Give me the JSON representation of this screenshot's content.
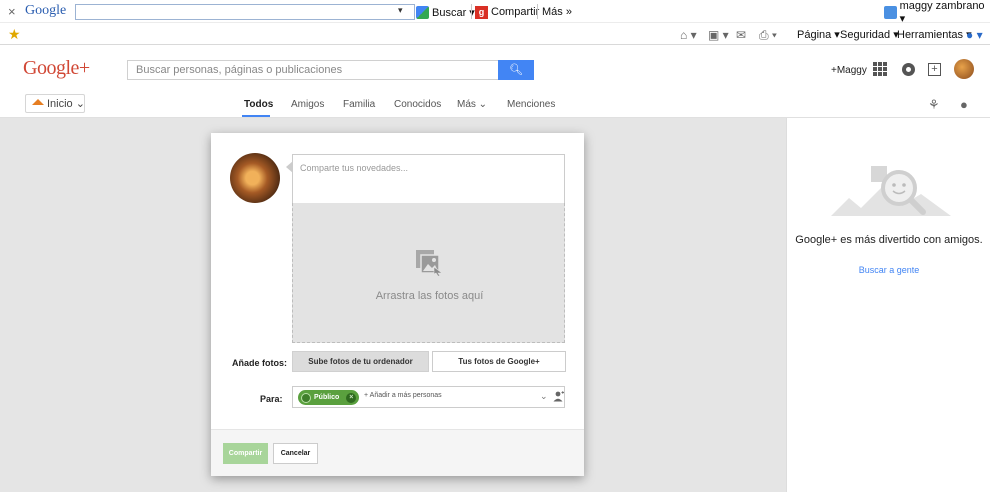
{
  "ie_toolbar": {
    "close": "×",
    "google_logo": "Google",
    "search_value": "",
    "dropdown": "▾",
    "buscar": "Buscar ▾",
    "compartir": "Compartir",
    "mas": "Más »",
    "user": "maggy zambrano ▾",
    "commands": {
      "pagina": "Página ▾",
      "seguridad": "Seguridad ▾",
      "herramientas": "Herramientas ▾"
    }
  },
  "gplus_header": {
    "logo": "Google+",
    "search_placeholder": "Buscar personas, páginas o publicaciones",
    "search_button_icon": "search-icon",
    "plus_name": "+Maggy"
  },
  "nav": {
    "home": "Inicio",
    "tabs": [
      "Todos",
      "Amigos",
      "Familia",
      "Conocidos",
      "Más ⌄",
      "Menciones"
    ],
    "active_tab": "Todos"
  },
  "right_panel": {
    "text": "Google+ es más divertido con amigos.",
    "link": "Buscar a gente"
  },
  "dialog": {
    "post_placeholder": "Comparte tus novedades...",
    "drop_text": "Arrastra las fotos aquí",
    "add_photos_label": "Añade fotos:",
    "upload_button": "Sube fotos de tu ordenador",
    "google_photos_button": "Tus fotos de Google+",
    "to_label": "Para:",
    "chip_label": "Público",
    "add_people": "+ Añadir a más personas",
    "share_button": "Compartir",
    "cancel_button": "Cancelar"
  },
  "colors": {
    "google_blue": "#4285f4",
    "gplus_red": "#d14836",
    "public_green": "#5aa03e"
  }
}
